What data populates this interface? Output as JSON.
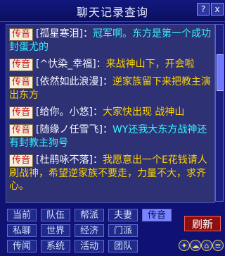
{
  "window": {
    "title": "聊天记录查询",
    "help_label": "?",
    "close_label": "x"
  },
  "messages": [
    {
      "badge": "传音",
      "name": "[孤星寒泪]",
      "colon": "：",
      "text": "冠军啊。东方是第一个成功封蛋尤的",
      "color": "#38f2ff"
    },
    {
      "badge": "传音",
      "name": "[^忕染_幸福]",
      "colon": "：",
      "text": "来战神山下，开会啦",
      "color": "#ffd200"
    },
    {
      "badge": "传音",
      "name": "[依然如此浪漫]",
      "colon": "：",
      "text": "逆家族留下来把教主演出东方",
      "color": "#ffd200"
    },
    {
      "badge": "传音",
      "name": "[给你。小悠]",
      "colon": "：",
      "text": "大家快出现 战神山",
      "color": "#ffd200"
    },
    {
      "badge": "传音",
      "name": "[随缘ノ任雪飞]",
      "colon": "：",
      "text": "WY还我大东方战神还有封教主狗号",
      "color": "#38f2ff"
    },
    {
      "badge": "传音",
      "name": "[杜鹃咏不落]",
      "colon": "：",
      "text": "我愿意出一个E花钱请人刷战神，希望逆家族不要走，力量不大，求齐心。",
      "color": "#ffd200"
    }
  ],
  "tabs": [
    [
      "当前",
      "队伍",
      "帮派",
      "夫妻",
      "传音"
    ],
    [
      "私聊",
      "世界",
      "经济",
      "门派"
    ],
    [
      "传闻",
      "系统",
      "活动",
      "团队"
    ]
  ],
  "active_tab": "传音",
  "refresh_label": "刷新",
  "icons": [
    "settings-icon",
    "chat-icon",
    "lock-icon",
    "menu-icon"
  ]
}
